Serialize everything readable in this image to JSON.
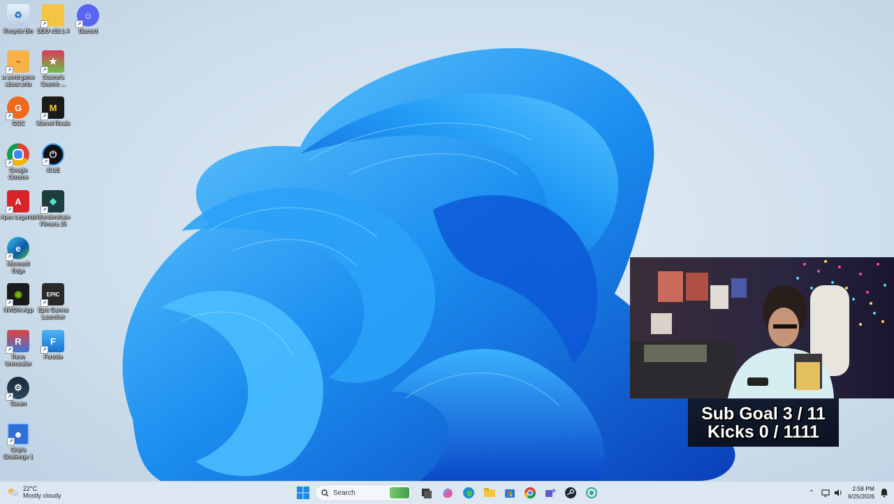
{
  "desktop": {
    "icons": [
      {
        "name": "recycle-bin",
        "label": "Recycle Bin"
      },
      {
        "name": "ddu",
        "label": "DDU v18.1.4"
      },
      {
        "name": "discord",
        "label": "Discord"
      },
      {
        "name": "word-game",
        "label": "a word game about ants"
      },
      {
        "name": "cosmos-cosmic",
        "label": "Cosmo's Cosmic ..."
      },
      {
        "name": "ggc",
        "label": "GGC"
      },
      {
        "name": "marvel-rivals",
        "label": "Marvel Rivals"
      },
      {
        "name": "google-chrome",
        "label": "Google Chrome"
      },
      {
        "name": "icue",
        "label": "iCUE"
      },
      {
        "name": "apex-legends",
        "label": "Apex Legends"
      },
      {
        "name": "filmora",
        "label": "Wondershare Filmora 15"
      },
      {
        "name": "microsoft-edge",
        "label": "Microsoft Edge"
      },
      {
        "name": "nvidia-app",
        "label": "NVIDIA App"
      },
      {
        "name": "epic-games",
        "label": "Epic Games Launcher"
      },
      {
        "name": "revo-uninstaller",
        "label": "Revo Uninstaller"
      },
      {
        "name": "fortnite",
        "label": "Fortnite"
      },
      {
        "name": "steam",
        "label": "Steam"
      },
      {
        "name": "chips-challenge",
        "label": "Chip's Challenge 1"
      }
    ]
  },
  "overlay": {
    "sub_goal": "Sub Goal 3 / 11",
    "kicks": "Kicks 0 / 1111"
  },
  "taskbar": {
    "weather_temp": "22°C",
    "weather_desc": "Mostly cloudy",
    "search_placeholder": "Search",
    "time": "2:58 PM",
    "date": "8/25/2026"
  },
  "colors": {
    "accent": "#1e88e5",
    "taskbar_bg": "#dee8f2"
  }
}
